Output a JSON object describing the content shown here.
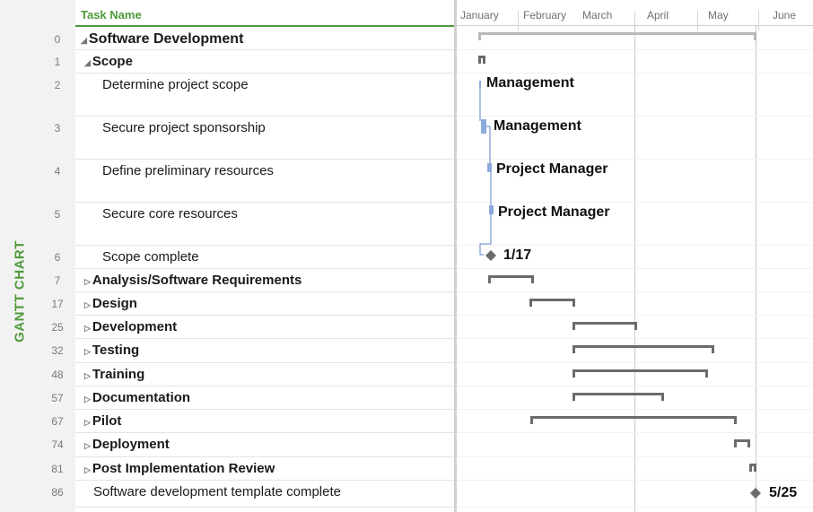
{
  "side_label": "GANTT CHART",
  "header": {
    "task_name": "Task Name"
  },
  "months": [
    "January",
    "February",
    "March",
    "April",
    "May",
    "June"
  ],
  "tasks": [
    {
      "id": "0",
      "name": "Software Development",
      "level": 0,
      "expanded": true,
      "bold": true
    },
    {
      "id": "1",
      "name": "Scope",
      "level": 1,
      "expanded": true,
      "bold": true
    },
    {
      "id": "2",
      "name": "Determine project scope",
      "level": 2,
      "bold": false,
      "resource": "Management"
    },
    {
      "id": "3",
      "name": "Secure project sponsorship",
      "level": 2,
      "bold": false,
      "resource": "Management"
    },
    {
      "id": "4",
      "name": "Define preliminary resources",
      "level": 2,
      "bold": false,
      "resource": "Project Manager"
    },
    {
      "id": "5",
      "name": "Secure core resources",
      "level": 2,
      "bold": false,
      "resource": "Project Manager"
    },
    {
      "id": "6",
      "name": "Scope complete",
      "level": 2,
      "bold": false,
      "milestone_label": "1/17"
    },
    {
      "id": "7",
      "name": "Analysis/Software Requirements",
      "level": 1,
      "expanded": false,
      "bold": true
    },
    {
      "id": "17",
      "name": "Design",
      "level": 1,
      "expanded": false,
      "bold": true
    },
    {
      "id": "25",
      "name": "Development",
      "level": 1,
      "expanded": false,
      "bold": true
    },
    {
      "id": "32",
      "name": "Testing",
      "level": 1,
      "expanded": false,
      "bold": true
    },
    {
      "id": "48",
      "name": "Training",
      "level": 1,
      "expanded": false,
      "bold": true
    },
    {
      "id": "57",
      "name": "Documentation",
      "level": 1,
      "expanded": false,
      "bold": true
    },
    {
      "id": "67",
      "name": "Pilot",
      "level": 1,
      "expanded": false,
      "bold": true
    },
    {
      "id": "74",
      "name": "Deployment",
      "level": 1,
      "expanded": false,
      "bold": true
    },
    {
      "id": "81",
      "name": "Post Implementation Review",
      "level": 1,
      "expanded": false,
      "bold": true
    },
    {
      "id": "86",
      "name": "Software development template complete",
      "level": 1,
      "bold": false,
      "milestone_label": "5/25"
    }
  ],
  "colors": {
    "accent": "#4e9a3c",
    "summary_bar": "#6b6b6b",
    "project_bar": "#b8b8b8",
    "task_bar": "#8eaadb",
    "link": "#5b85c9",
    "milestone": "#6b6b6b"
  },
  "icons": {
    "expanded": "triangle-down-icon",
    "collapsed": "triangle-right-icon"
  }
}
